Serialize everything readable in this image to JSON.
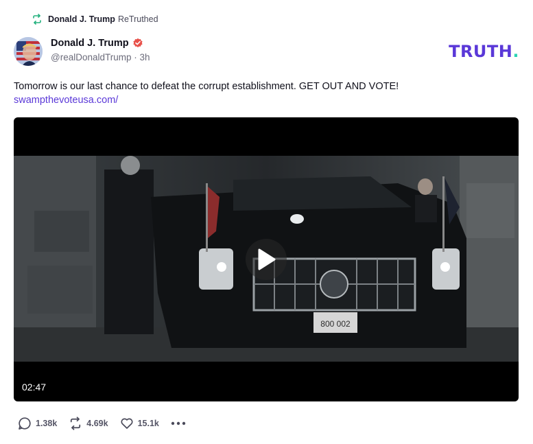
{
  "retruth": {
    "name": "Donald J. Trump",
    "action": "ReTruthed",
    "icon": "retruth-icon",
    "icon_color": "#22b07d"
  },
  "post": {
    "author_name": "Donald J. Trump",
    "verified_icon": "verified-badge-icon",
    "verified_color": "#e8514a",
    "handle": "@realDonaldTrump",
    "time": "3h",
    "handle_time": "@realDonaldTrump · 3h",
    "text": "Tomorrow is our last chance to defeat the corrupt establishment. GET OUT AND VOTE!",
    "link": "swampthevoteusa.com/",
    "link_color": "#5a38d8"
  },
  "brand": {
    "logo_text": "TRUTH",
    "logo_dot": ".",
    "logo_color": "#5a38d8",
    "dot_color": "#2bd4b4"
  },
  "video": {
    "duration": "02:47",
    "plate_text": "800 002",
    "play_icon": "play-icon"
  },
  "actions": {
    "replies": {
      "icon": "reply-icon",
      "count": "1.38k"
    },
    "retruths": {
      "icon": "retruth-icon",
      "count": "4.69k"
    },
    "likes": {
      "icon": "heart-icon",
      "count": "15.1k"
    },
    "more_icon": "more-options-icon"
  }
}
